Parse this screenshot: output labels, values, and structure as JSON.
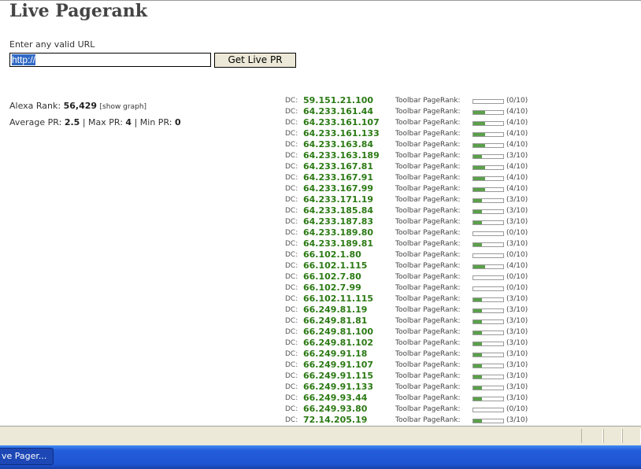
{
  "page": {
    "title": "Live Pagerank"
  },
  "form": {
    "url_label": "Enter any valid URL",
    "url_value": "http://",
    "submit_label": "Get Live PR"
  },
  "stats": {
    "alexa_label": "Alexa Rank:",
    "alexa_value": "56,429",
    "show_graph": "[show graph]",
    "avg_label": "Average PR:",
    "avg_value": "2.5",
    "max_label": "Max PR:",
    "max_value": "4",
    "min_label": "Min PR:",
    "min_value": "0",
    "separator": "|"
  },
  "dc_prefix": "DC:",
  "toolbar_label": "Toolbar PageRank:",
  "datacenters": [
    {
      "ip": "59.151.21.100",
      "pr": 0,
      "score": "(0/10)"
    },
    {
      "ip": "64.233.161.44",
      "pr": 4,
      "score": "(4/10)"
    },
    {
      "ip": "64.233.161.107",
      "pr": 4,
      "score": "(4/10)"
    },
    {
      "ip": "64.233.161.133",
      "pr": 4,
      "score": "(4/10)"
    },
    {
      "ip": "64.233.163.84",
      "pr": 4,
      "score": "(4/10)"
    },
    {
      "ip": "64.233.163.189",
      "pr": 3,
      "score": "(3/10)"
    },
    {
      "ip": "64.233.167.81",
      "pr": 4,
      "score": "(4/10)"
    },
    {
      "ip": "64.233.167.91",
      "pr": 4,
      "score": "(4/10)"
    },
    {
      "ip": "64.233.167.99",
      "pr": 4,
      "score": "(4/10)"
    },
    {
      "ip": "64.233.171.19",
      "pr": 3,
      "score": "(3/10)"
    },
    {
      "ip": "64.233.185.84",
      "pr": 3,
      "score": "(3/10)"
    },
    {
      "ip": "64.233.187.83",
      "pr": 3,
      "score": "(3/10)"
    },
    {
      "ip": "64.233.189.80",
      "pr": 0,
      "score": "(0/10)"
    },
    {
      "ip": "64.233.189.81",
      "pr": 3,
      "score": "(3/10)"
    },
    {
      "ip": "66.102.1.80",
      "pr": 0,
      "score": "(0/10)"
    },
    {
      "ip": "66.102.1.115",
      "pr": 4,
      "score": "(4/10)"
    },
    {
      "ip": "66.102.7.80",
      "pr": 0,
      "score": "(0/10)"
    },
    {
      "ip": "66.102.7.99",
      "pr": 0,
      "score": "(0/10)"
    },
    {
      "ip": "66.102.11.115",
      "pr": 3,
      "score": "(3/10)"
    },
    {
      "ip": "66.249.81.19",
      "pr": 3,
      "score": "(3/10)"
    },
    {
      "ip": "66.249.81.81",
      "pr": 3,
      "score": "(3/10)"
    },
    {
      "ip": "66.249.81.100",
      "pr": 3,
      "score": "(3/10)"
    },
    {
      "ip": "66.249.81.102",
      "pr": 3,
      "score": "(3/10)"
    },
    {
      "ip": "66.249.91.18",
      "pr": 3,
      "score": "(3/10)"
    },
    {
      "ip": "66.249.91.107",
      "pr": 3,
      "score": "(3/10)"
    },
    {
      "ip": "66.249.91.115",
      "pr": 3,
      "score": "(3/10)"
    },
    {
      "ip": "66.249.91.133",
      "pr": 3,
      "score": "(3/10)"
    },
    {
      "ip": "66.249.93.44",
      "pr": 3,
      "score": "(3/10)"
    },
    {
      "ip": "66.249.93.80",
      "pr": 0,
      "score": "(0/10)"
    },
    {
      "ip": "72.14.205.19",
      "pr": 3,
      "score": "(3/10)"
    }
  ],
  "taskbar": {
    "window_button": "ve Pager..."
  },
  "colors": {
    "ip_green": "#2b7a14",
    "bar_green": "#5aa04a",
    "selection_blue": "#316ac5",
    "taskbar_blue": "#245edb"
  }
}
